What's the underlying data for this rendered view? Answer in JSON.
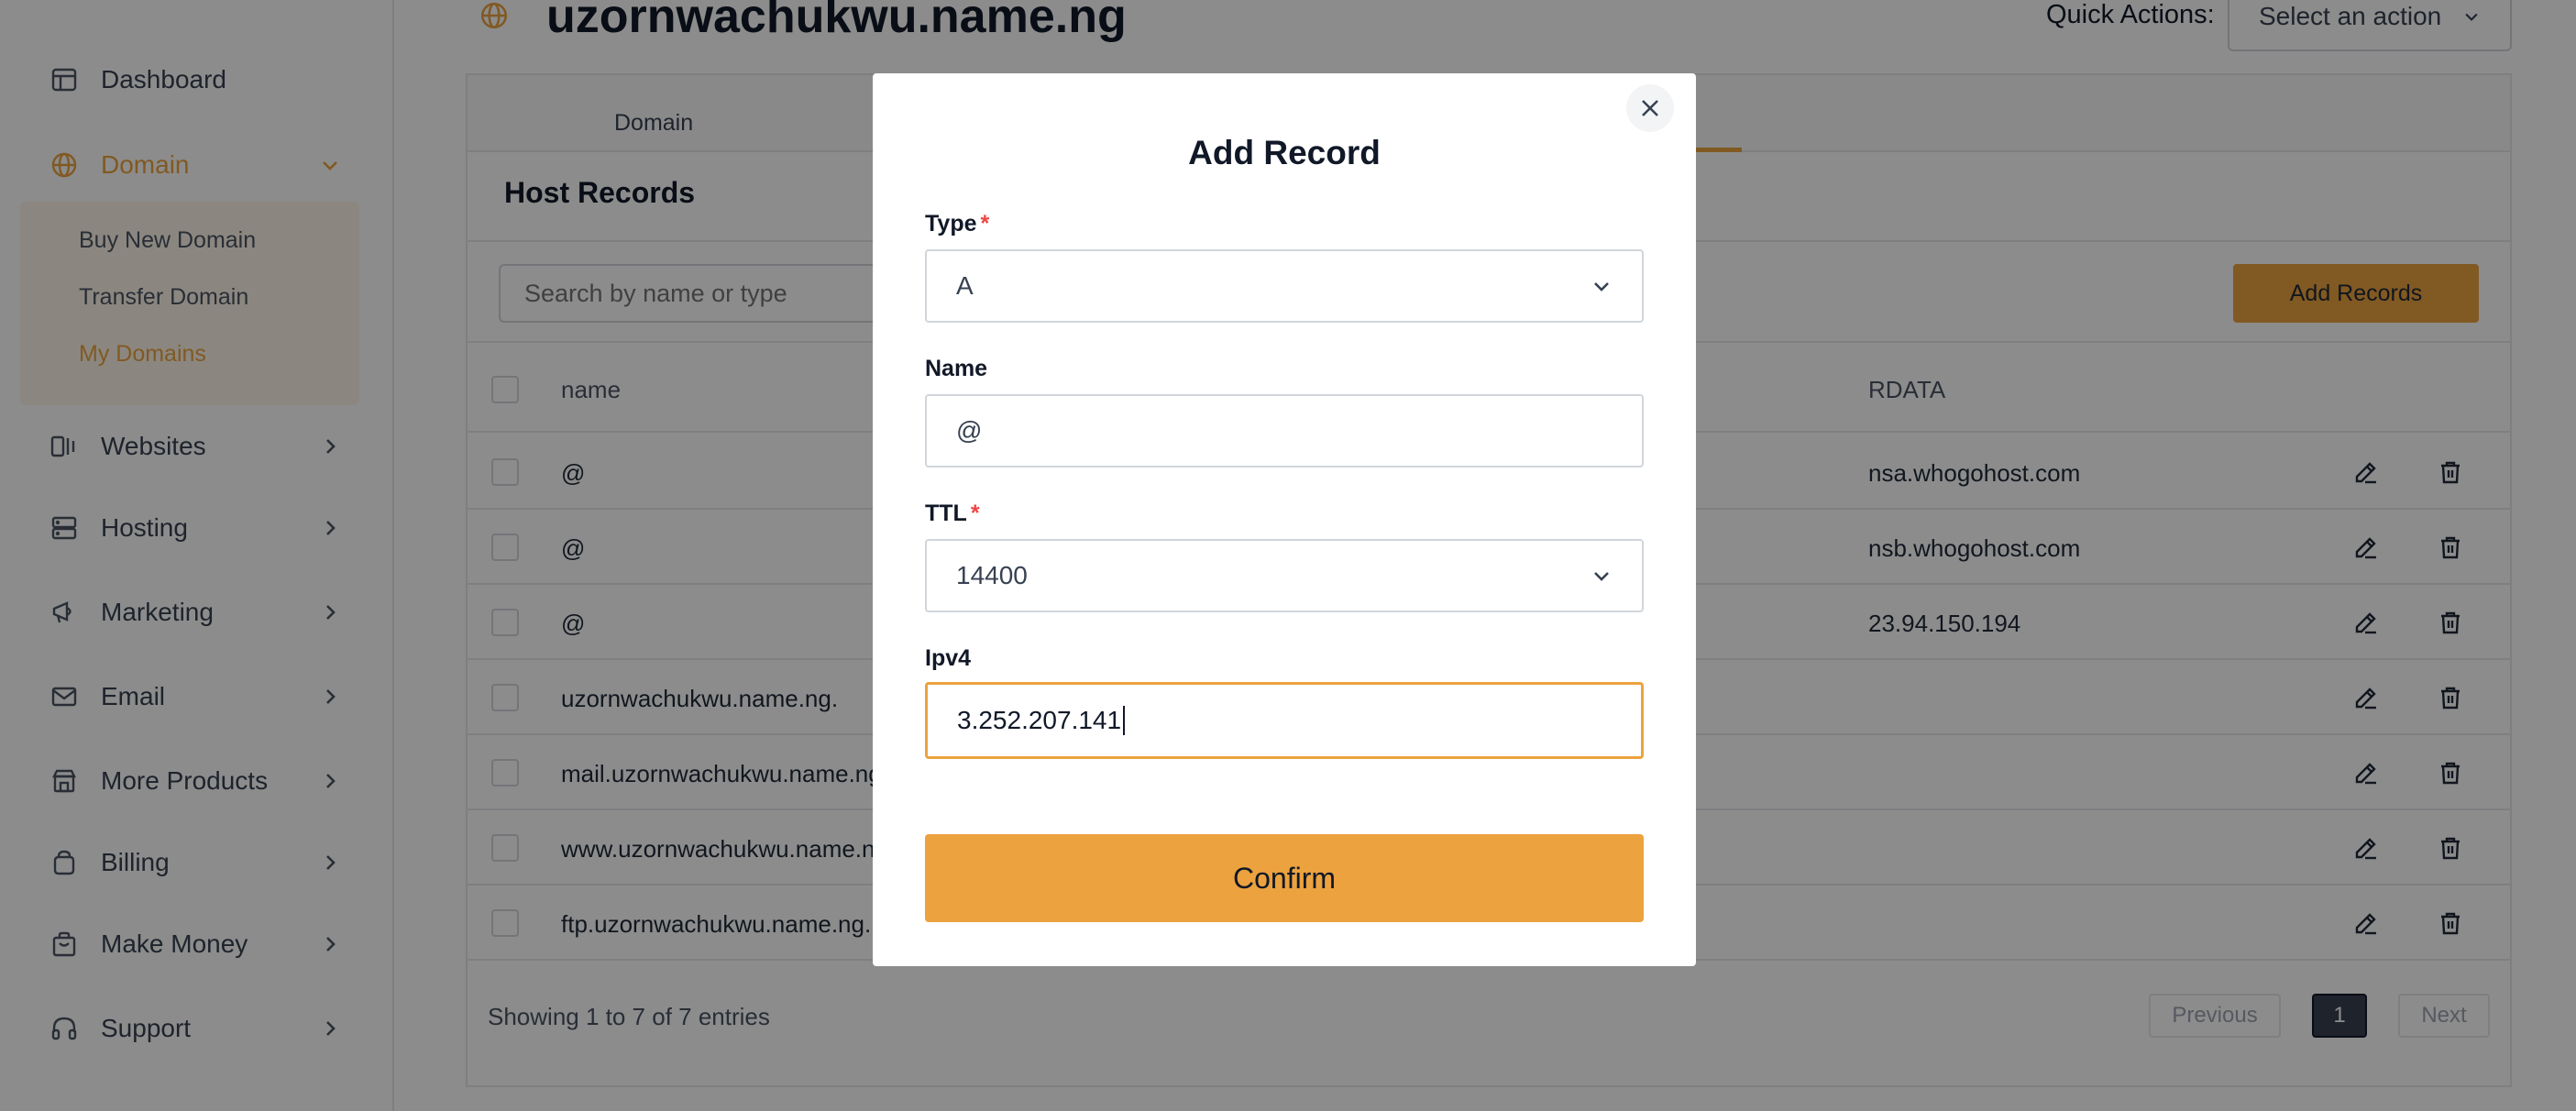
{
  "sidebar": {
    "items": [
      {
        "label": "Dashboard",
        "icon": "dashboard-icon"
      },
      {
        "label": "Domain",
        "icon": "globe-icon"
      },
      {
        "label": "Websites",
        "icon": "websites-icon"
      },
      {
        "label": "Hosting",
        "icon": "server-icon"
      },
      {
        "label": "Marketing",
        "icon": "megaphone-icon"
      },
      {
        "label": "Email",
        "icon": "mail-icon"
      },
      {
        "label": "More Products",
        "icon": "store-icon"
      },
      {
        "label": "Billing",
        "icon": "wallet-icon"
      },
      {
        "label": "Make Money",
        "icon": "bag-icon"
      },
      {
        "label": "Support",
        "icon": "headset-icon"
      }
    ],
    "domain_submenu": [
      "Buy New Domain",
      "Transfer Domain",
      "My Domains"
    ],
    "active_color": "#eca23e"
  },
  "header": {
    "title": "uzornwachukwu.name.ng",
    "quick_actions_label": "Quick Actions:",
    "quick_actions_value": "Select an action"
  },
  "tabs": [
    "Domain"
  ],
  "host_records": {
    "title": "Host Records",
    "search_placeholder": "Search by name or type",
    "add_button": "Add Records",
    "columns": {
      "name": "name",
      "rdata": "RDATA"
    },
    "rows": [
      {
        "name": "@",
        "rdata": "nsa.whogohost.com"
      },
      {
        "name": "@",
        "rdata": "nsb.whogohost.com"
      },
      {
        "name": "@",
        "rdata": "23.94.150.194"
      },
      {
        "name": "uzornwachukwu.name.ng.",
        "rdata": ""
      },
      {
        "name": "mail.uzornwachukwu.name.ng.",
        "rdata": ""
      },
      {
        "name": "www.uzornwachukwu.name.ng.",
        "rdata": ""
      },
      {
        "name": "ftp.uzornwachukwu.name.ng.",
        "rdata": ""
      }
    ],
    "footer": "Showing 1 to 7 of 7 entries",
    "pagination": {
      "previous": "Previous",
      "page": "1",
      "next": "Next"
    }
  },
  "modal": {
    "title": "Add Record",
    "type_label": "Type",
    "type_value": "A",
    "name_label": "Name",
    "name_value": "@",
    "ttl_label": "TTL",
    "ttl_value": "14400",
    "ipv4_label": "Ipv4",
    "ipv4_value": "3.252.207.141",
    "required_mark": "*",
    "confirm_label": "Confirm"
  }
}
